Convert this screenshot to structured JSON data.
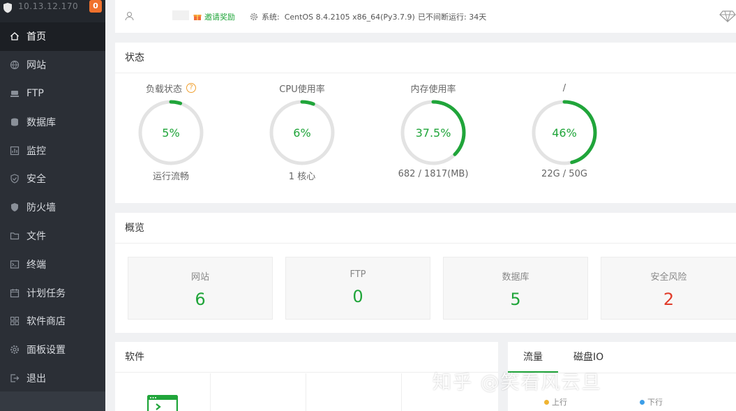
{
  "sidebar": {
    "ip": "10.13.12.170",
    "badge_count": "0",
    "items": [
      {
        "label": "首页",
        "icon": "home-icon"
      },
      {
        "label": "网站",
        "icon": "globe-icon"
      },
      {
        "label": "FTP",
        "icon": "ftp-icon"
      },
      {
        "label": "数据库",
        "icon": "database-icon"
      },
      {
        "label": "监控",
        "icon": "monitor-icon"
      },
      {
        "label": "安全",
        "icon": "shield-check-icon"
      },
      {
        "label": "防火墙",
        "icon": "firewall-icon"
      },
      {
        "label": "文件",
        "icon": "folder-icon"
      },
      {
        "label": "终端",
        "icon": "terminal-icon"
      },
      {
        "label": "计划任务",
        "icon": "calendar-icon"
      },
      {
        "label": "软件商店",
        "icon": "grid-icon"
      },
      {
        "label": "面板设置",
        "icon": "gear-icon"
      },
      {
        "label": "退出",
        "icon": "logout-icon"
      }
    ]
  },
  "header": {
    "invite": "邀请奖励",
    "system_label": "系统:",
    "system_value": "CentOS 8.4.2105 x86_64(Py3.7.9)",
    "uptime": "已不间断运行: 34天"
  },
  "status": {
    "title": "状态",
    "gauges": [
      {
        "label": "负载状态",
        "value": "5%",
        "percent": 5,
        "sub": "运行流畅"
      },
      {
        "label": "CPU使用率",
        "value": "6%",
        "percent": 6,
        "sub": "1 核心"
      },
      {
        "label": "内存使用率",
        "value": "37.5%",
        "percent": 37.5,
        "sub": "682 / 1817(MB)"
      },
      {
        "label": "/",
        "value": "46%",
        "percent": 46,
        "sub": "22G / 50G"
      }
    ]
  },
  "overview": {
    "title": "概览",
    "cards": [
      {
        "label": "网站",
        "value": "6"
      },
      {
        "label": "FTP",
        "value": "0"
      },
      {
        "label": "数据库",
        "value": "5"
      },
      {
        "label": "安全风险",
        "value": "2"
      }
    ]
  },
  "software": {
    "title": "软件"
  },
  "traffic": {
    "tabs": [
      "流量",
      "磁盘IO"
    ],
    "legend_up": "上行",
    "legend_down": "下行"
  },
  "watermark": "知乎 @笑看风云旦",
  "colors": {
    "accent": "#20a53a",
    "danger": "#e13b2a",
    "sidebar": "#2b2f36",
    "legend_up": "#f0b432",
    "legend_down": "#3c9ee8"
  }
}
